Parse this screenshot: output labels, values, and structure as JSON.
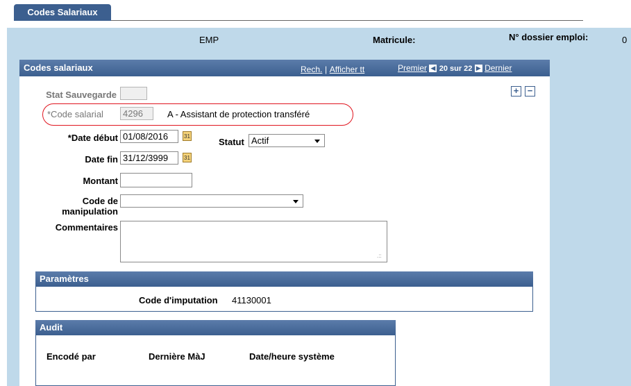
{
  "tab": {
    "label": "Codes Salariaux"
  },
  "header": {
    "emp": "EMP",
    "matricule_label": "Matricule:",
    "dossier_label": "N° dossier emploi:",
    "dossier_value": "0"
  },
  "panel": {
    "title": "Codes salariaux",
    "search_link": "Rech.",
    "separator": "|",
    "show_all_link": "Afficher tt",
    "first_link": "Premier",
    "counter": "20 sur 22",
    "last_link": "Dernier",
    "add_symbol": "+",
    "remove_symbol": "−"
  },
  "form": {
    "stat_label": "Stat Sauvegarde",
    "stat_value": "",
    "code_label": "*Code salarial",
    "code_value": "4296",
    "code_desc": "A - Assistant de protection transféré",
    "date_debut_label": "*Date début",
    "date_debut_value": "01/08/2016",
    "statut_label": "Statut",
    "statut_value": "Actif",
    "date_fin_label": "Date fin",
    "date_fin_value": "31/12/3999",
    "montant_label": "Montant",
    "montant_value": "",
    "code_manip_label_1": "Code de",
    "code_manip_label_2": "manipulation",
    "code_manip_value": "",
    "commentaires_label": "Commentaires",
    "commentaires_value": "",
    "calendar_glyph": "31"
  },
  "parametres": {
    "title": "Paramètres",
    "imputation_label": "Code d'imputation",
    "imputation_value": "41130001"
  },
  "audit": {
    "title": "Audit",
    "col_encode": "Encodé par",
    "col_maj": "Dernière MàJ",
    "col_date": "Date/heure système"
  },
  "colors": {
    "header_blue": "#3c5f8f",
    "frame_light_blue": "#bfd9ea",
    "highlight_red": "#e0141e"
  },
  "icons": [
    "calendar-icon",
    "dropdown-arrow-icon",
    "prev-arrow-icon",
    "next-arrow-icon",
    "add-row-icon",
    "delete-row-icon"
  ]
}
